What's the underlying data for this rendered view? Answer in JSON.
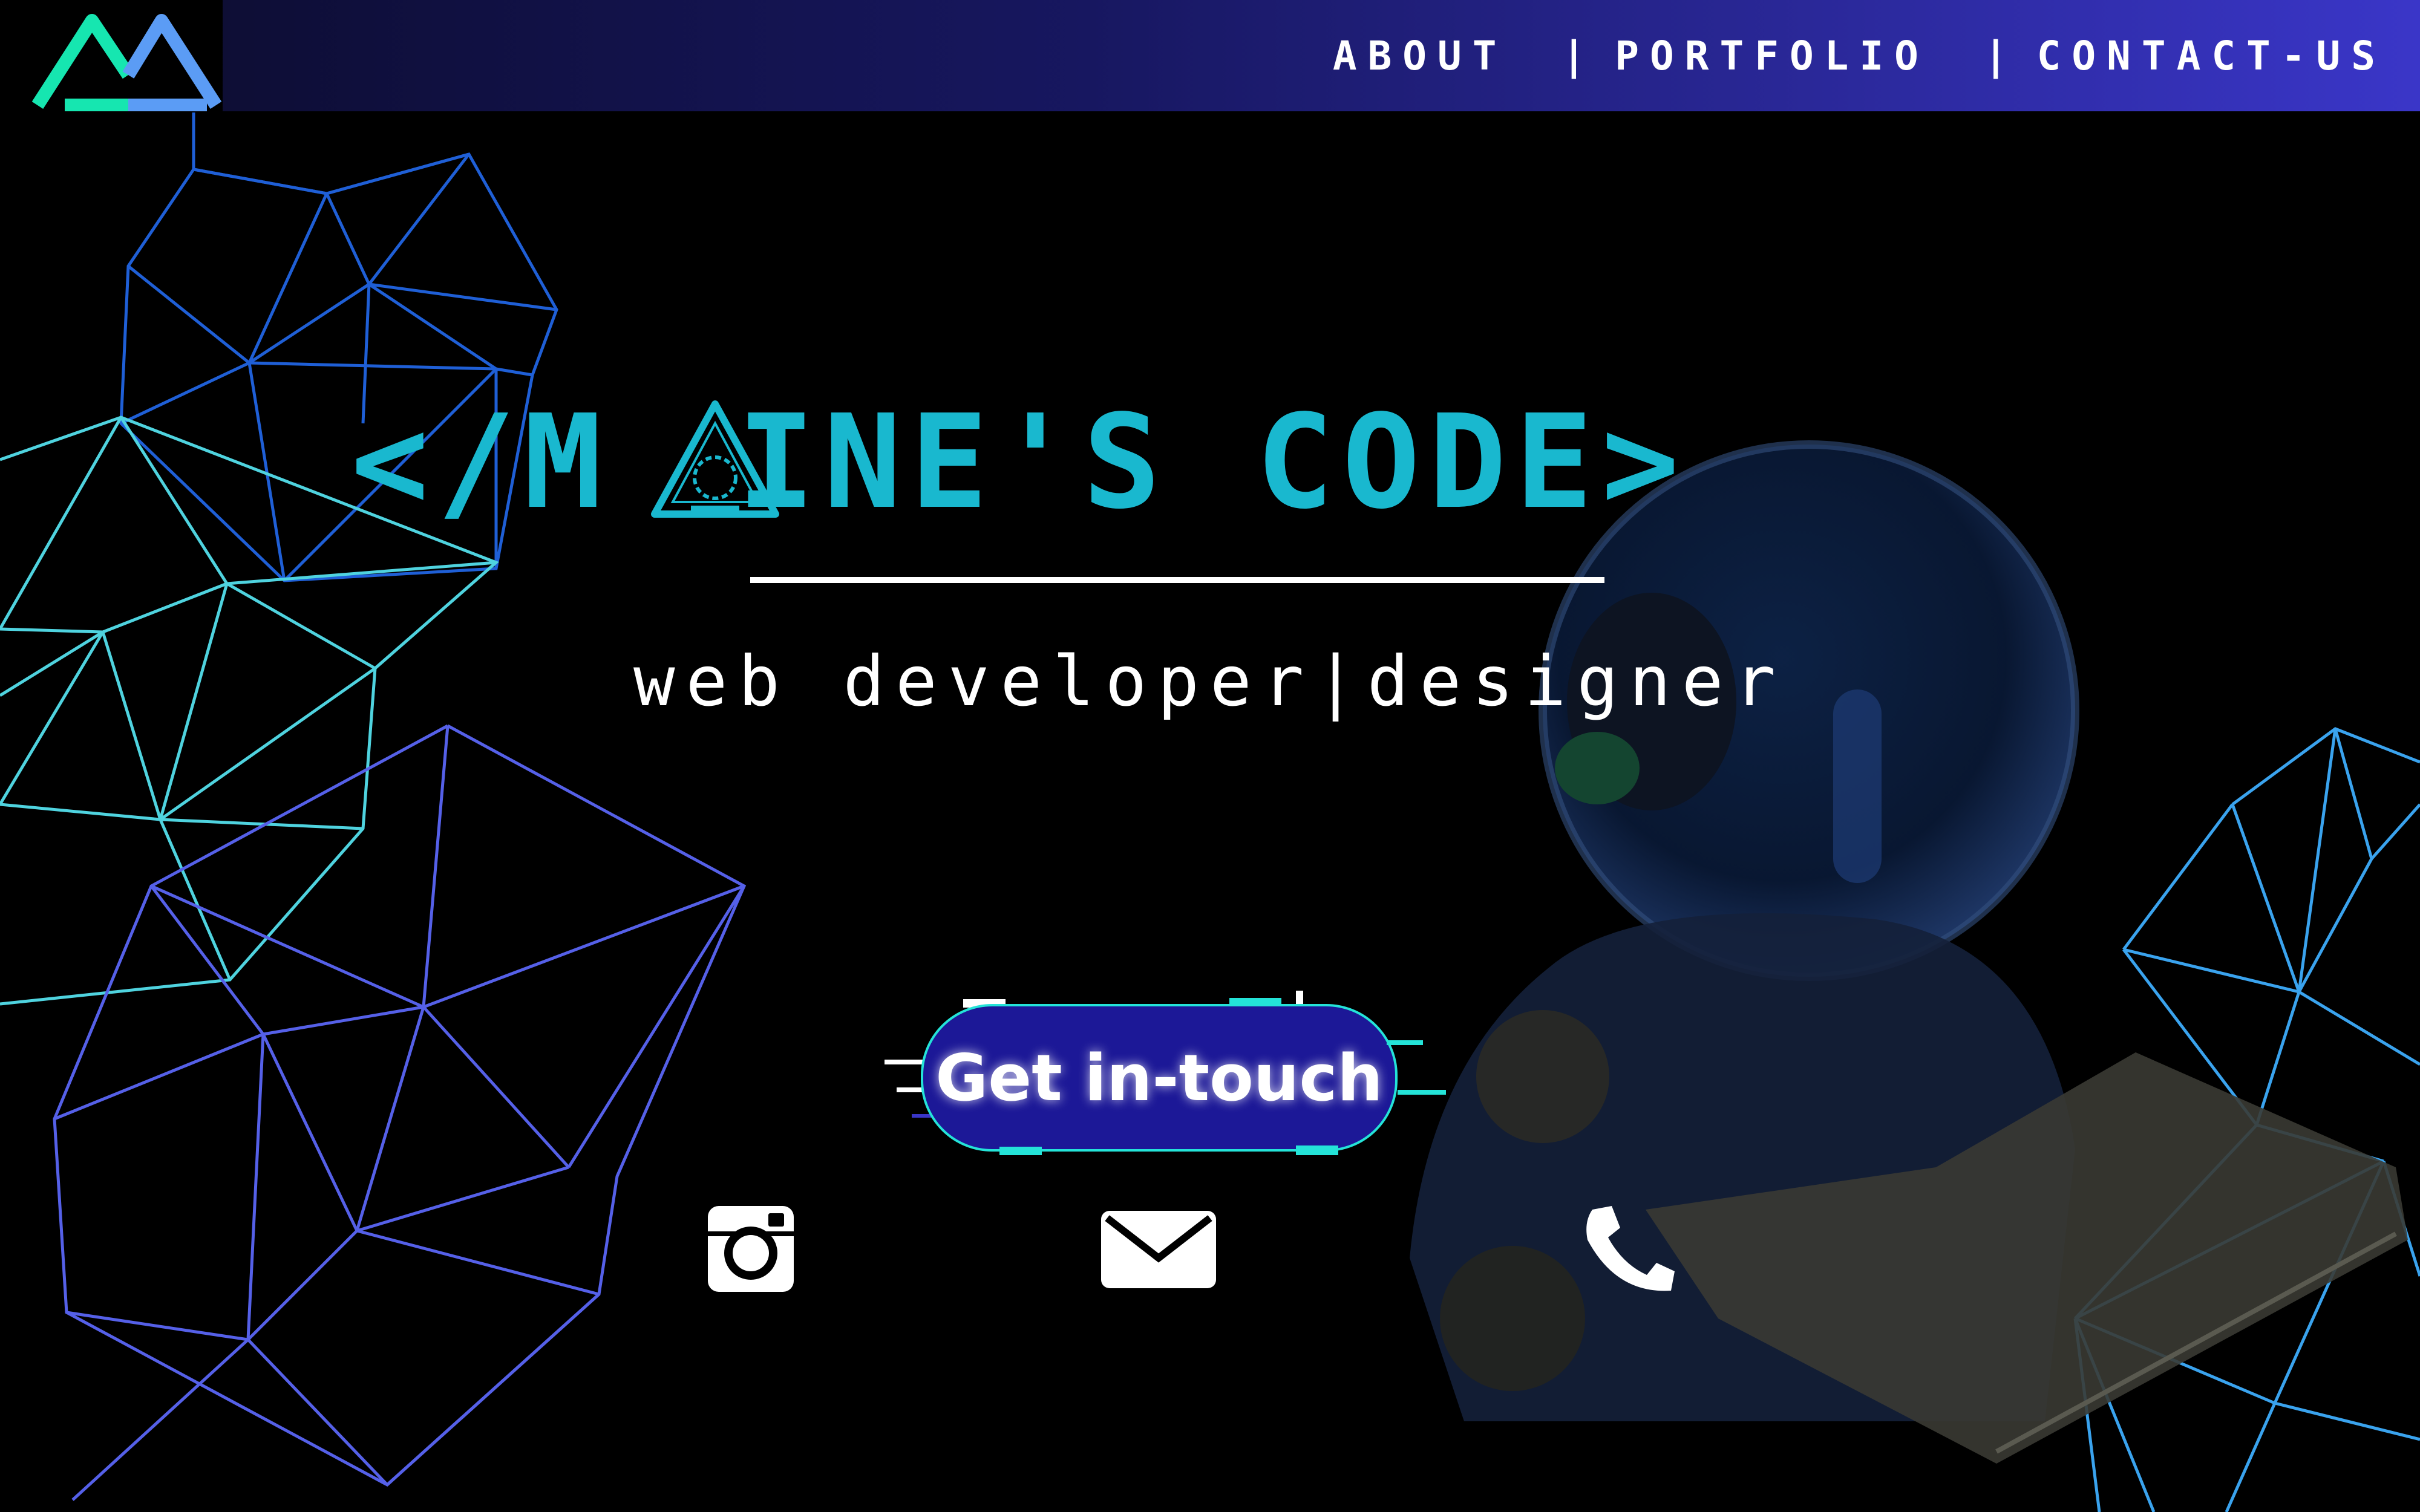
{
  "nav": {
    "links": [
      "About",
      "Portfolio",
      "Contact-us"
    ],
    "separator": "|"
  },
  "hero": {
    "title_left": "</M",
    "title_right": "INE'S CODE>",
    "subtitle": "web developer|designer",
    "cta_label": "Get in-touch"
  },
  "social": {
    "icons": [
      "instagram-icon",
      "mail-icon",
      "phone-icon"
    ]
  },
  "colors": {
    "title": "#19b8cf",
    "nav_gradient_start": "#0b0b2a",
    "nav_gradient_end": "#3a36c8",
    "cta_fill": "#1c1897",
    "cta_glitch": "#24e3d8",
    "mesh_teal": "#4fd3df",
    "mesh_blue": "#1f5fd6",
    "mesh_violet": "#5560e8",
    "mesh_sky": "#3aa3ee"
  }
}
